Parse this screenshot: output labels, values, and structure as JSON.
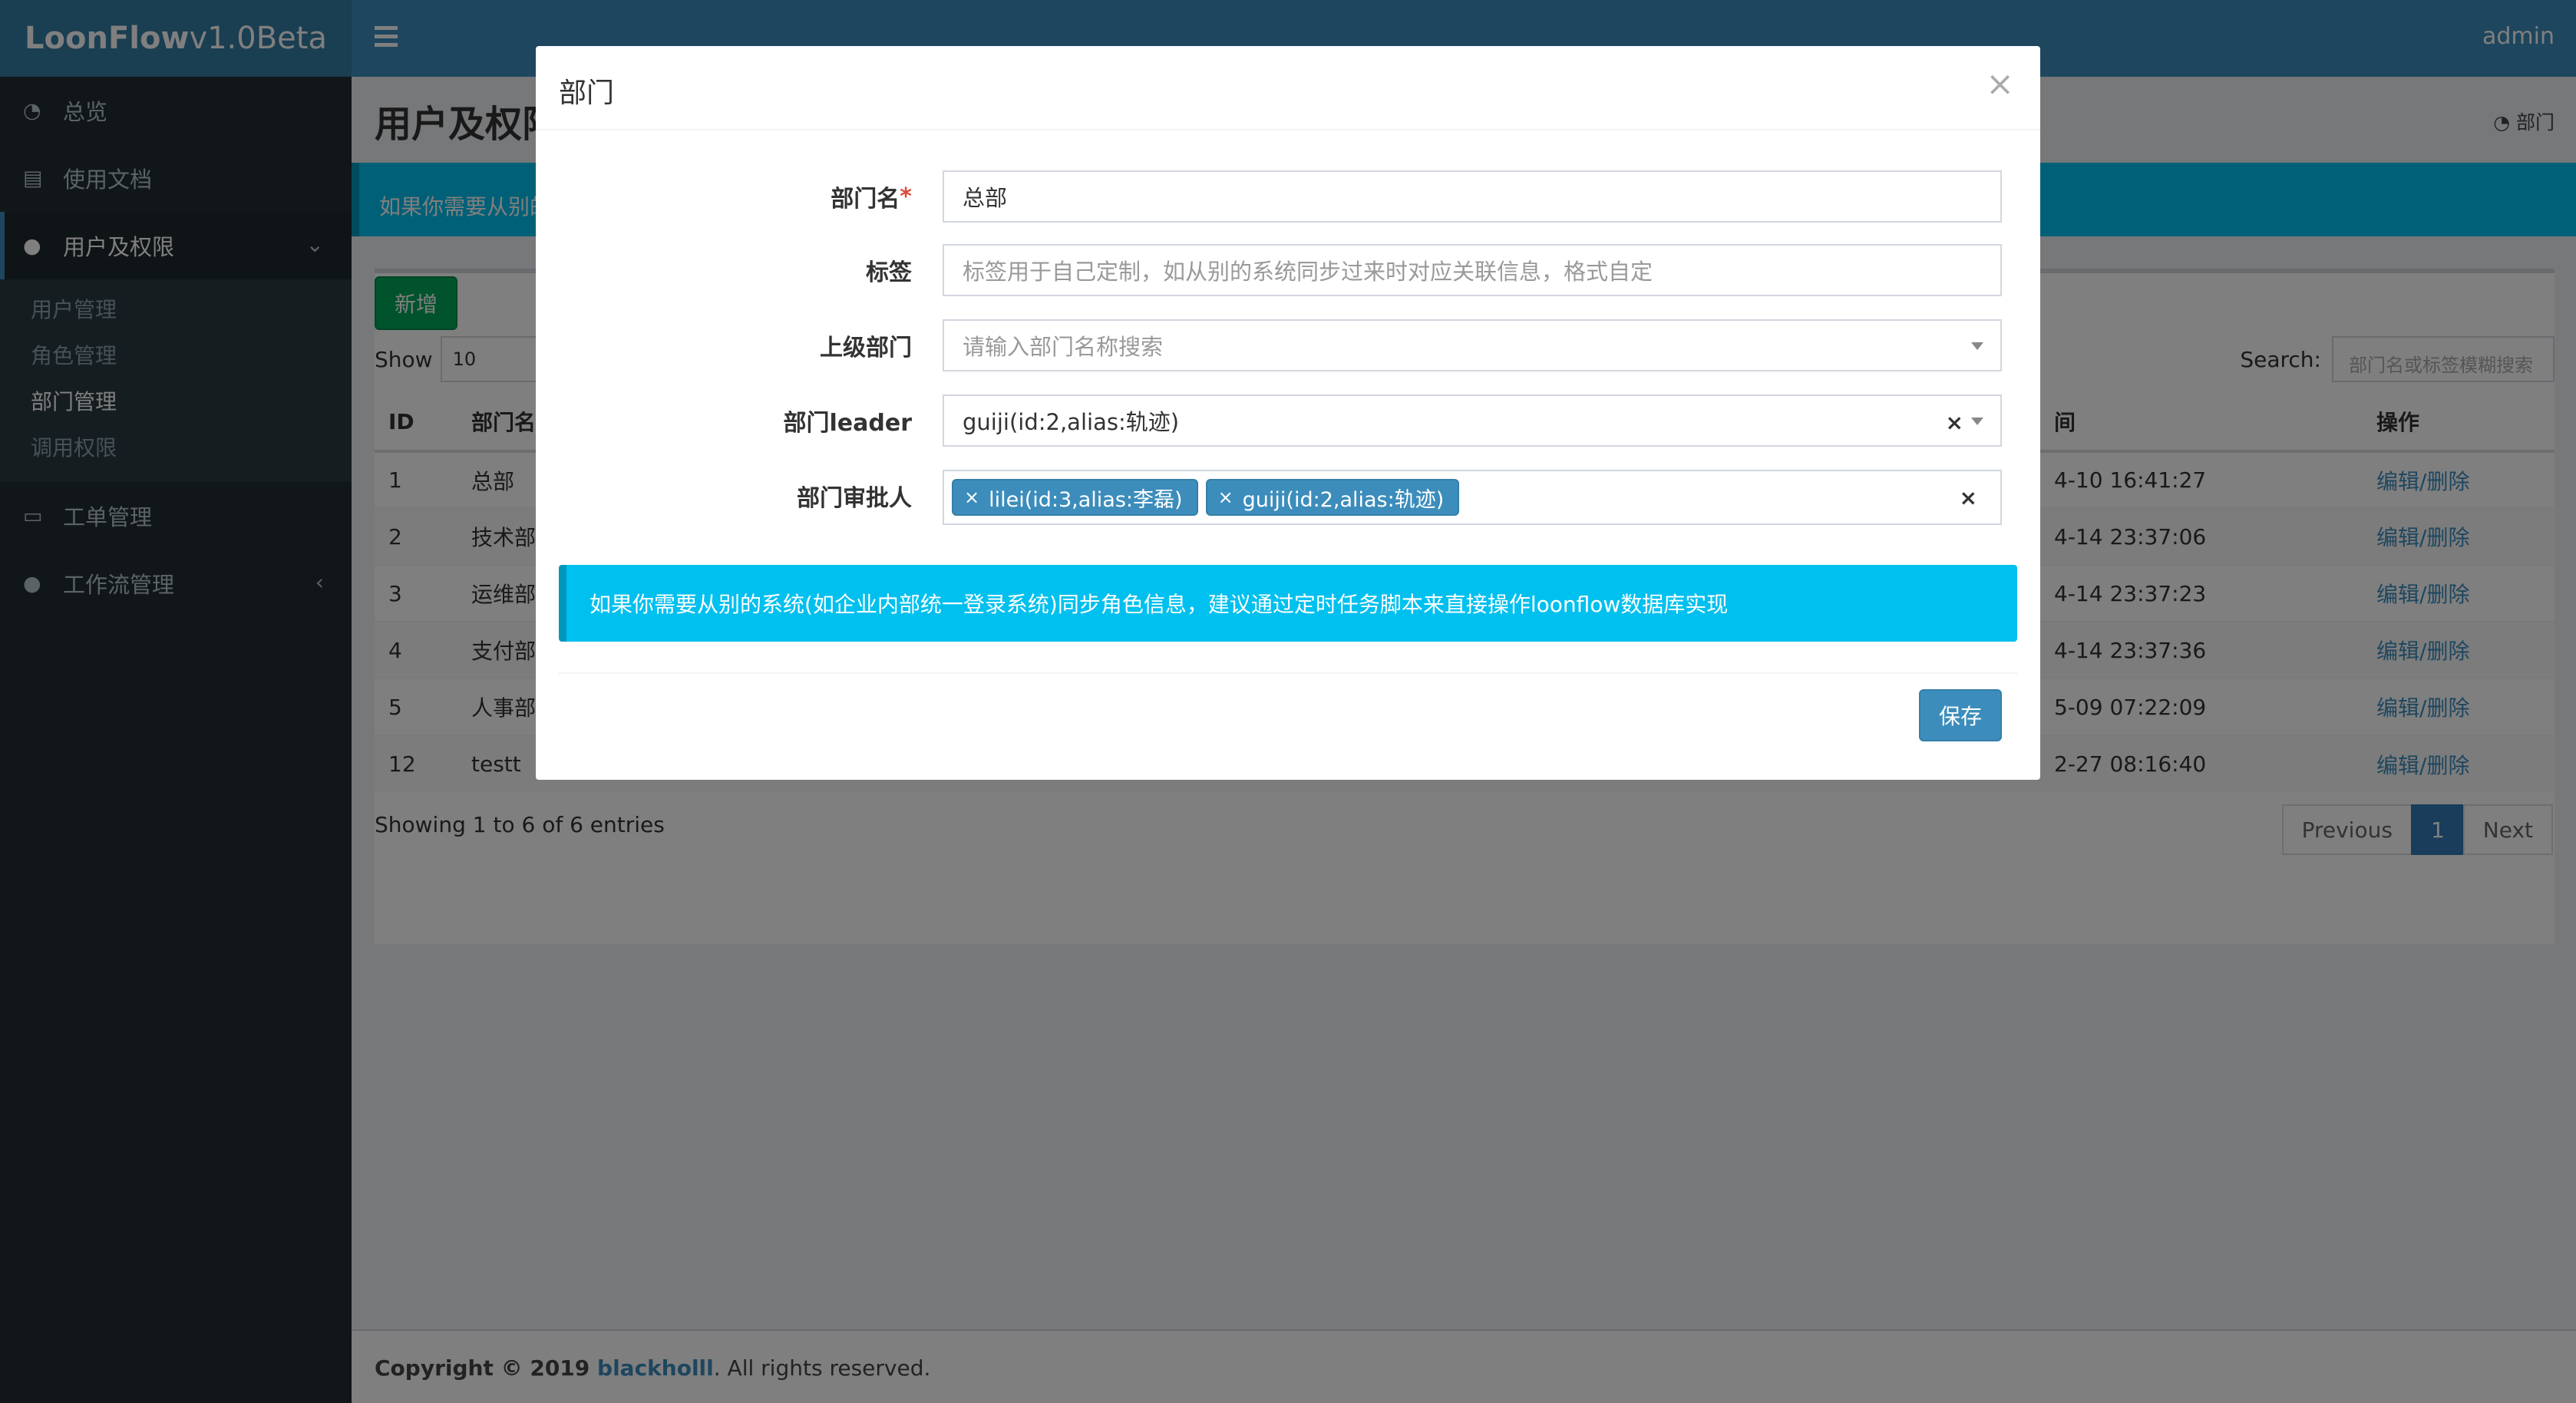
{
  "app": {
    "logo_bold": "LoonFlow",
    "logo_version": " v1.0Beta",
    "user": "admin"
  },
  "sidebar": {
    "items": [
      {
        "label": "总览"
      },
      {
        "label": "使用文档"
      },
      {
        "label": "用户及权限"
      },
      {
        "label": "工单管理"
      },
      {
        "label": "工作流管理"
      }
    ],
    "subitems": [
      {
        "label": "用户管理"
      },
      {
        "label": "角色管理"
      },
      {
        "label": "部门管理"
      },
      {
        "label": "调用权限"
      }
    ]
  },
  "content": {
    "title": "用户及权限",
    "crumb": "部门",
    "callout": "如果你需要从别的",
    "add_button": "新增",
    "show_label": "Show",
    "page_size": "10",
    "search_label": "Search:",
    "search_placeholder": "部门名或标签模糊搜索",
    "columns": {
      "id": "ID",
      "name": "部门名",
      "time": "间",
      "ops": "操作"
    },
    "rows": [
      {
        "id": "1",
        "name": "总部",
        "time": "4-10 16:41:27"
      },
      {
        "id": "2",
        "name": "技术部",
        "time": "4-14 23:37:06"
      },
      {
        "id": "3",
        "name": "运维部",
        "time": "4-14 23:37:23"
      },
      {
        "id": "4",
        "name": "支付部",
        "time": "4-14 23:37:36"
      },
      {
        "id": "5",
        "name": "人事部",
        "time": "5-09 07:22:09"
      },
      {
        "id": "12",
        "name": "testt",
        "time": "2-27 08:16:40"
      }
    ],
    "edit": "编辑",
    "sep": "/",
    "delete": "删除",
    "showing": "Showing 1 to 6 of 6 entries",
    "pager": {
      "prev": "Previous",
      "current": "1",
      "next": "Next"
    },
    "footer": {
      "prefix": "Copyright © 2019 ",
      "author": "blackholll",
      "suffix": ". All rights reserved."
    }
  },
  "modal": {
    "title": "部门",
    "close": "×",
    "fields": {
      "name_label": "部门名",
      "required_mark": "*",
      "name_value": "总部",
      "label_label": "标签",
      "label_placeholder": "标签用于自己定制，如从别的系统同步过来时对应关联信息，格式自定",
      "parent_label": "上级部门",
      "parent_placeholder": "请输入部门名称搜索",
      "leader_label": "部门leader",
      "leader_value": "guiji(id:2,alias:轨迹)",
      "approver_label": "部门审批人",
      "approvers": [
        {
          "label": "lilei(id:3,alias:李磊)"
        },
        {
          "label": "guiji(id:2,alias:轨迹)"
        }
      ],
      "tag_remove": "×",
      "clear": "×"
    },
    "callout": "如果你需要从别的系统(如企业内部统一登录系统)同步角色信息，建议通过定时任务脚本来直接操作loonflow数据库实现",
    "save_button": "保存"
  },
  "colors": {
    "header": "#3c8dbc",
    "sidebar": "#222d32",
    "info": "#00c0ef",
    "success": "#00a65a"
  }
}
